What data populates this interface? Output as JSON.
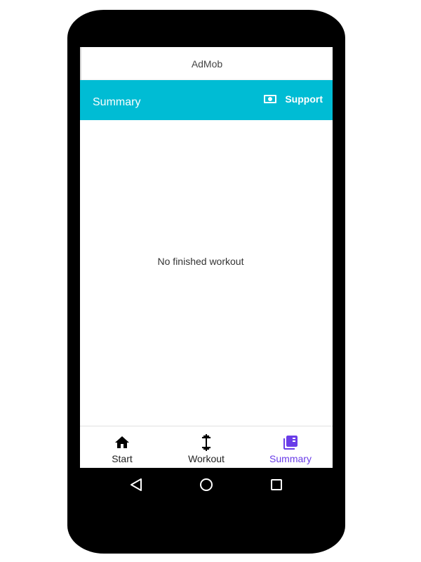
{
  "ad_banner": {
    "label": "AdMob"
  },
  "appbar": {
    "title": "Summary",
    "support_label": "Support",
    "support_icon": "cash-icon"
  },
  "main": {
    "empty_message": "No finished workout"
  },
  "bottom_nav": {
    "items": [
      {
        "label": "Start",
        "icon": "home-icon",
        "active": false
      },
      {
        "label": "Workout",
        "icon": "dumbbell-icon",
        "active": false
      },
      {
        "label": "Summary",
        "icon": "library-books-icon",
        "active": true
      }
    ]
  },
  "system_nav": {
    "buttons": [
      "back-icon",
      "home-circle-icon",
      "recents-icon"
    ]
  },
  "colors": {
    "appbar": "#00bcd4",
    "active": "#6a3de8",
    "frame": "#000000"
  }
}
